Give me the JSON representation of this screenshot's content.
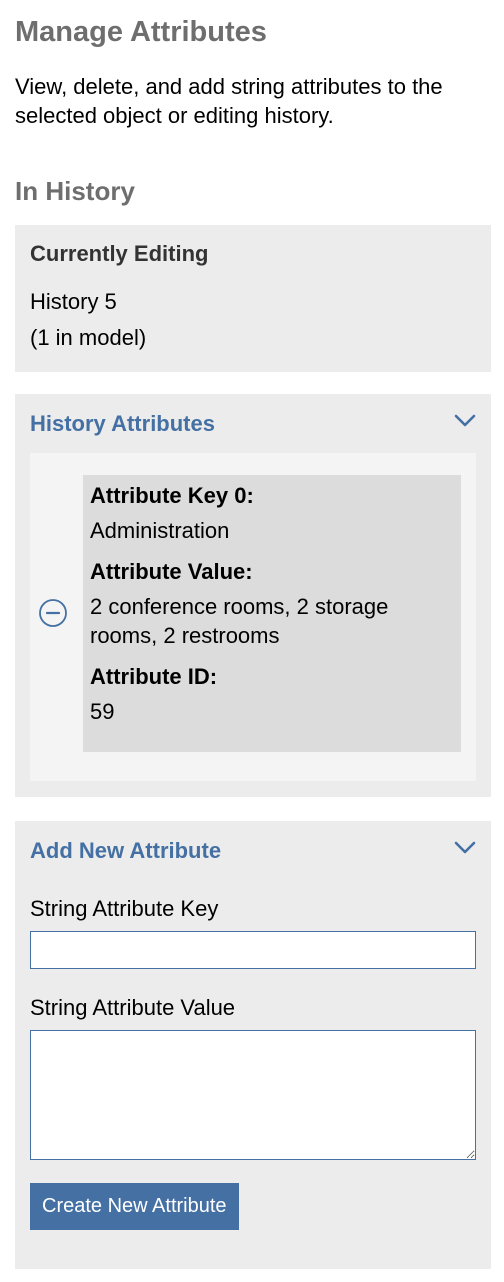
{
  "header": {
    "title": "Manage Attributes",
    "description": "View, delete, and add string attributes to the selected object or editing history."
  },
  "history_section": {
    "title": "In History",
    "currently_editing": {
      "heading": "Currently Editing",
      "name": "History 5",
      "count": "(1 in model)"
    },
    "history_attributes": {
      "heading": "History Attributes",
      "expanded": true,
      "items": [
        {
          "key_label": "Attribute Key 0:",
          "key": "Administration",
          "value_label": "Attribute Value:",
          "value": "2 conference rooms, 2 storage rooms, 2 restrooms",
          "id_label": "Attribute ID:",
          "id": "59"
        }
      ]
    },
    "add_new": {
      "heading": "Add New Attribute",
      "expanded": true,
      "key_label": "String Attribute Key",
      "key_value": "",
      "value_label": "String Attribute Value",
      "value_value": "",
      "button_label": "Create New Attribute"
    }
  },
  "icons": {
    "chevron": "chevron-down-icon",
    "remove": "minus-circle-icon"
  },
  "colors": {
    "accent": "#4470a4",
    "panel_bg": "#ececec",
    "heading_gray": "#6e6e6e",
    "card_bg": "#dcdcdc"
  }
}
